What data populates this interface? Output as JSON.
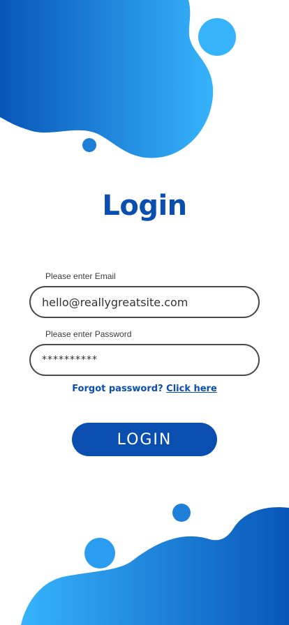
{
  "login": {
    "title": "Login",
    "email_label": "Please enter Email",
    "email_value": "hello@reallygreatsite.com",
    "password_label": "Please enter Password",
    "password_value": "**********",
    "forgot_text": "Forgot password?",
    "forgot_link": "Click here",
    "button_label": "LOGIN"
  },
  "colors": {
    "brand": "#0a4fb0",
    "blob_light": "#36b3fb",
    "blob_dark": "#0856b8",
    "field_border": "#4a4a4a"
  }
}
